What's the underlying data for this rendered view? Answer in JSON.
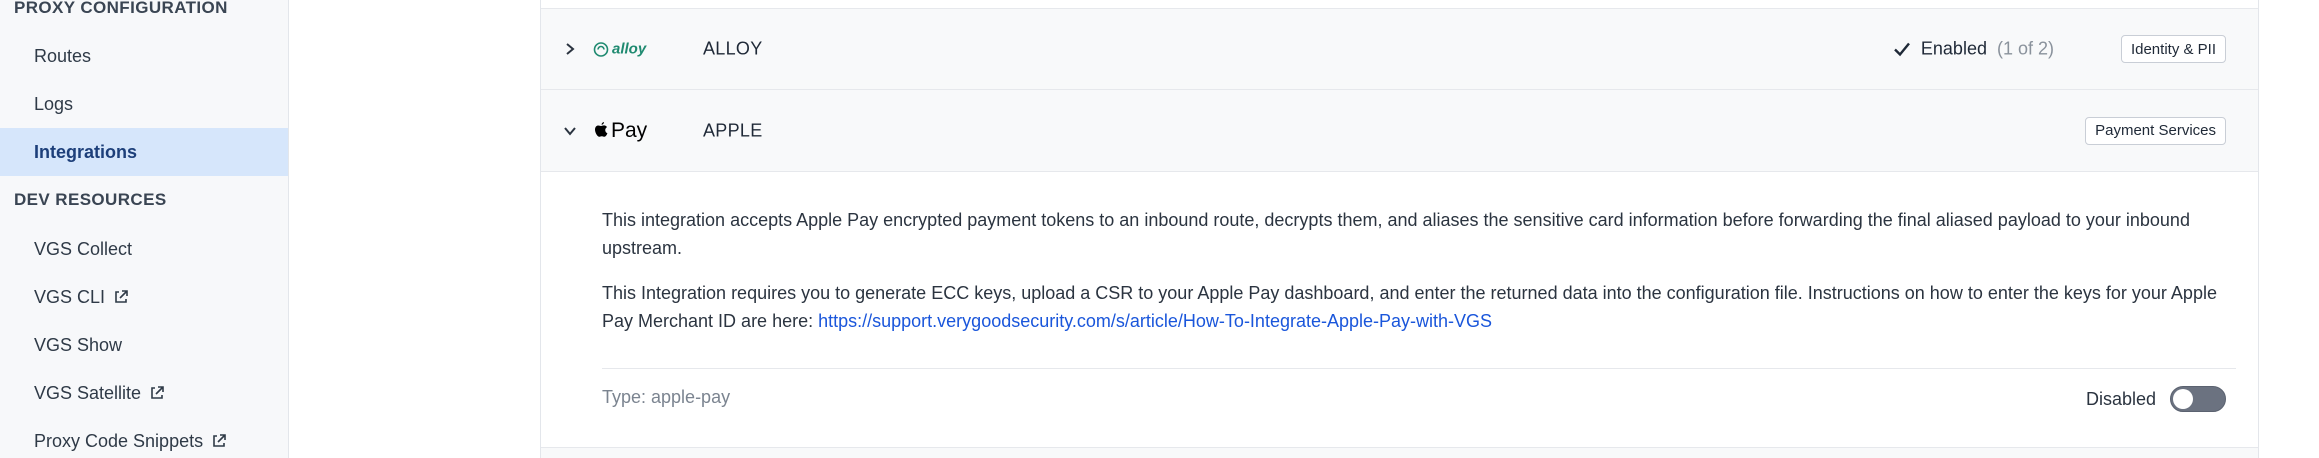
{
  "sidebar": {
    "sections": [
      {
        "title": "PROXY CONFIGURATION"
      },
      {
        "title": "DEV RESOURCES"
      }
    ],
    "items": [
      {
        "label": "Routes"
      },
      {
        "label": "Logs"
      },
      {
        "label": "Integrations"
      },
      {
        "label": "VGS Collect"
      },
      {
        "label": "VGS CLI"
      },
      {
        "label": "VGS Show"
      },
      {
        "label": "VGS Satellite"
      },
      {
        "label": "Proxy Code Snippets"
      }
    ]
  },
  "integrations": [
    {
      "name": "ALLOY",
      "logo_text": "alloy",
      "status": "Enabled",
      "count": "(1 of 2)",
      "tag": "Identity & PII",
      "expanded": false
    },
    {
      "name": "APPLE",
      "logo_text": "Pay",
      "tag": "Payment Services",
      "expanded": true,
      "description1": "This integration accepts Apple Pay encrypted payment tokens to an inbound route, decrypts them, and aliases the sensitive card information before forwarding the final aliased payload to your inbound upstream.",
      "description2": "This Integration requires you to generate ECC keys, upload a CSR to your Apple Pay dashboard, and enter the returned data into the configuration file. Instructions on how to enter the keys for your Apple Pay Merchant ID are here: ",
      "link": "https://support.verygoodsecurity.com/s/article/How-To-Integrate-Apple-Pay-with-VGS",
      "type_label": "Type: apple-pay",
      "toggle_label": "Disabled"
    }
  ],
  "colors": {
    "active_bg": "#d6e6fb",
    "link": "#1a56db",
    "alloy_green": "#1f8a70"
  }
}
